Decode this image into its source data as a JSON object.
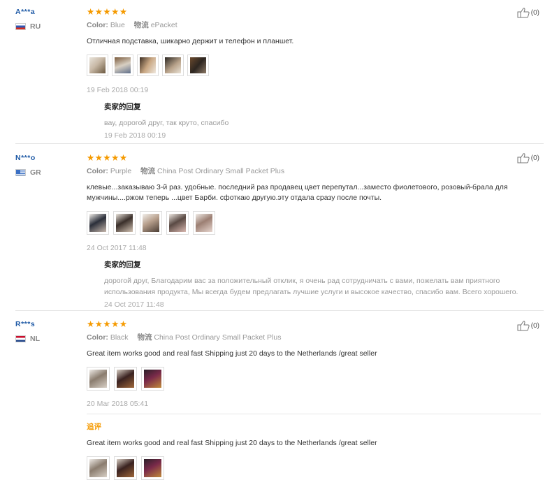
{
  "reviews": [
    {
      "user": "A***a",
      "country": "RU",
      "color_label": "Color:",
      "color": "Blue",
      "ship_label": "物流",
      "ship": "ePacket",
      "text": "Отличная подставка, шикарно держит и телефон и планшет.",
      "date": "19 Feb 2018 00:19",
      "reply_title": "卖家的回复",
      "reply_text": "вау, дорогой друг, так круто, спасибо",
      "reply_date": "19 Feb 2018 00:19",
      "helpful": "(0)"
    },
    {
      "user": "N***o",
      "country": "GR",
      "color_label": "Color:",
      "color": "Purple",
      "ship_label": "物流",
      "ship": "China Post Ordinary Small Packet Plus",
      "text": "клевые...заказываю 3-й раз. удобные. последний раз продавец цвет перепутал...заместо фиолетового, розовый-брала для мужчины....ржом теперь ...цвет Барби. сфоткаю другую.эту отдала сразу после почты.",
      "date": "24 Oct 2017 11:48",
      "reply_title": "卖家的回复",
      "reply_text": "дорогой друг, Благодарим вас за положительный отклик, я очень рад сотрудничать с вами, пожелать вам приятного использования продукта, Мы всегда будем предлагать лучшие услуги и высокое качество, спасибо вам. Всего хорошего.",
      "reply_date": "24 Oct 2017 11:48",
      "helpful": "(0)"
    },
    {
      "user": "R***s",
      "country": "NL",
      "color_label": "Color:",
      "color": "Black",
      "ship_label": "物流",
      "ship": "China Post Ordinary Small Packet Plus",
      "text": "Great item works good and real fast Shipping just 20 days to the Netherlands /great seller",
      "date": "20 Mar 2018 05:41",
      "append_title": "追评",
      "append_text": "Great item works good and real fast Shipping just 20 days to the Netherlands /great seller",
      "helpful": "(0)"
    }
  ],
  "stars": "★★★★★",
  "colors": {
    "star": "#f59a00",
    "username": "#1f5aa6"
  }
}
